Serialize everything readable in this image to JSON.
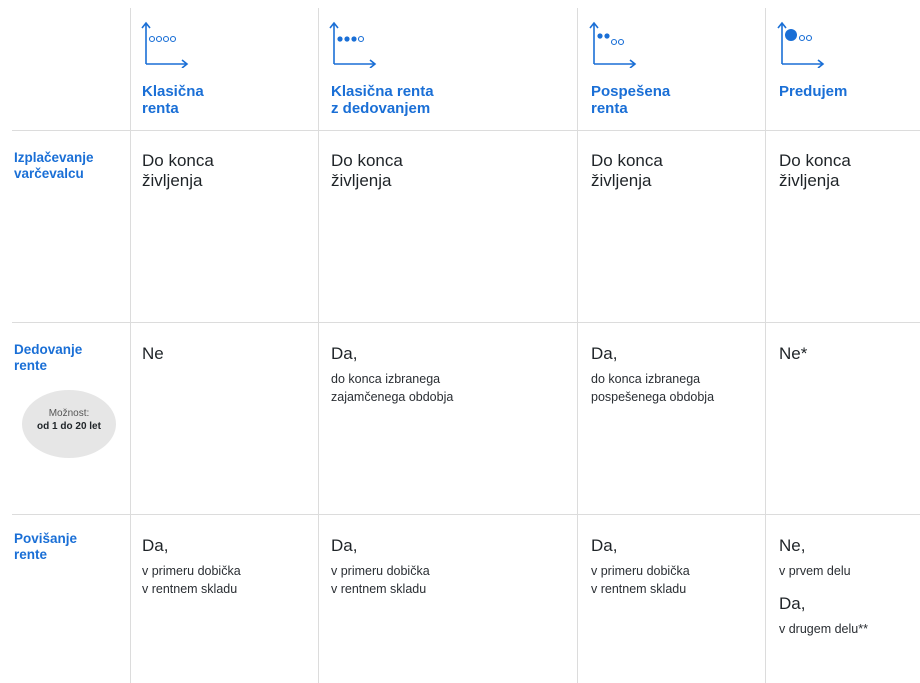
{
  "columns": [
    {
      "title_line1": "Klasična",
      "title_line2": "renta",
      "icon": "chart-axis-four-empty-dots-icon"
    },
    {
      "title_line1": "Klasična renta",
      "title_line2": "z dedovanjem",
      "icon": "chart-axis-three-filled-one-empty-dots-icon"
    },
    {
      "title_line1": "Pospešena",
      "title_line2": "renta",
      "icon": "chart-axis-two-filled-two-empty-dots-icon"
    },
    {
      "title_line1": "Predujem",
      "title_line2": "",
      "icon": "chart-axis-big-dot-two-empty-dots-icon"
    }
  ],
  "rows": {
    "izplacevanje": {
      "label_line1": "Izplačevanje",
      "label_line2": "varčevalcu",
      "cells": [
        {
          "line1": "Do konca",
          "line2": "življenja"
        },
        {
          "line1": "Do konca",
          "line2": "življenja"
        },
        {
          "line1": "Do konca",
          "line2": "življenja"
        },
        {
          "line1": "Do konca",
          "line2": "življenja"
        }
      ]
    },
    "dedovanje": {
      "label_line1": "Dedovanje",
      "label_line2": "rente",
      "badge_line1": "Možnost:",
      "badge_line2": "od 1 do 20 let",
      "cells": [
        {
          "main": "Ne",
          "sub1": "",
          "sub2": ""
        },
        {
          "main": "Da,",
          "sub1": "do konca izbranega",
          "sub2": "zajamčenega obdobja"
        },
        {
          "main": "Da,",
          "sub1": "do konca izbranega",
          "sub2": "pospešenega obdobja"
        },
        {
          "main": "Ne*",
          "sub1": "",
          "sub2": ""
        }
      ]
    },
    "povisanje": {
      "label_line1": "Povišanje",
      "label_line2": "rente",
      "cells": [
        {
          "main": "Da,",
          "sub1": "v primeru dobička",
          "sub2": "v rentnem skladu"
        },
        {
          "main": "Da,",
          "sub1": "v primeru dobička",
          "sub2": "v rentnem skladu"
        },
        {
          "main": "Da,",
          "sub1": "v primeru dobička",
          "sub2": "v rentnem skladu"
        }
      ],
      "last_cell": {
        "main1": "Ne,",
        "sub1": "v prvem delu",
        "main2": "Da,",
        "sub2": "v drugem delu**"
      }
    }
  },
  "colors": {
    "accent": "#1a6fd6",
    "text": "#1f2428",
    "divider": "#dcdcdc",
    "badge": "#e6e6e6"
  }
}
